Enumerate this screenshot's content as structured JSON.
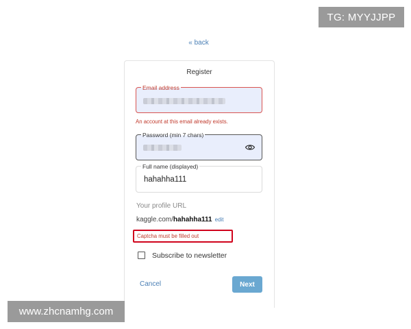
{
  "watermarks": {
    "top": "TG: MYYJJPP",
    "bottom": "www.zhcnamhg.com"
  },
  "nav": {
    "back_label": "« back"
  },
  "form": {
    "title": "Register",
    "email": {
      "label": "Email address",
      "error": "An account at this email already exists."
    },
    "password": {
      "label": "Password (min 7 chars)",
      "toggle_icon": "eye-icon"
    },
    "full_name": {
      "label": "Full name (displayed)",
      "value": "hahahha111"
    },
    "profile_url": {
      "label": "Your profile URL",
      "prefix": "kaggle.com/",
      "username": "hahahha111",
      "edit_label": "edit"
    },
    "captcha_error": "Captcha must be filled out",
    "newsletter": {
      "label": "Subscribe to newsletter",
      "checked": false
    },
    "cancel_label": "Cancel",
    "next_label": "Next"
  },
  "colors": {
    "accent": "#4a7fb5",
    "error": "#c0392b",
    "primary_button": "#6aa8d1",
    "autofill_bg": "#e9eefc",
    "watermark_bg": "#9a9a9a"
  }
}
